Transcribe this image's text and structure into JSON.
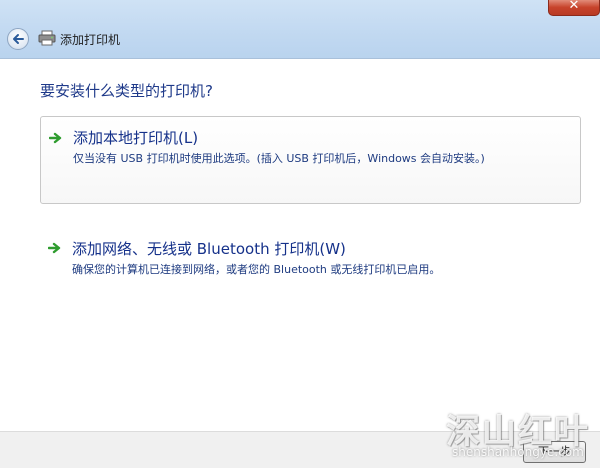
{
  "window": {
    "title": "添加打印机",
    "close_label": "✕"
  },
  "heading": "要安装什么类型的打印机?",
  "options": [
    {
      "title": "添加本地打印机(L)",
      "description": "仅当没有 USB 打印机时使用此选项。(插入 USB 打印机后，Windows 会自动安装。)"
    },
    {
      "title": "添加网络、无线或 Bluetooth 打印机(W)",
      "description": "确保您的计算机已连接到网络，或者您的 Bluetooth 或无线打印机已启用。"
    }
  ],
  "footer": {
    "next_label": "下一步"
  },
  "watermark": {
    "brand": "深山红叶",
    "url": "shenshanhongye.com"
  },
  "icons": {
    "back": "back-arrow-icon",
    "printer": "printer-icon",
    "option_arrow": "green-arrow-icon"
  },
  "colors": {
    "titlebar": "#c2d9f1",
    "heading": "#1f3a8a",
    "option_text": "#15318a",
    "arrow_green": "#2e9c2e",
    "close_red": "#c7432b"
  }
}
